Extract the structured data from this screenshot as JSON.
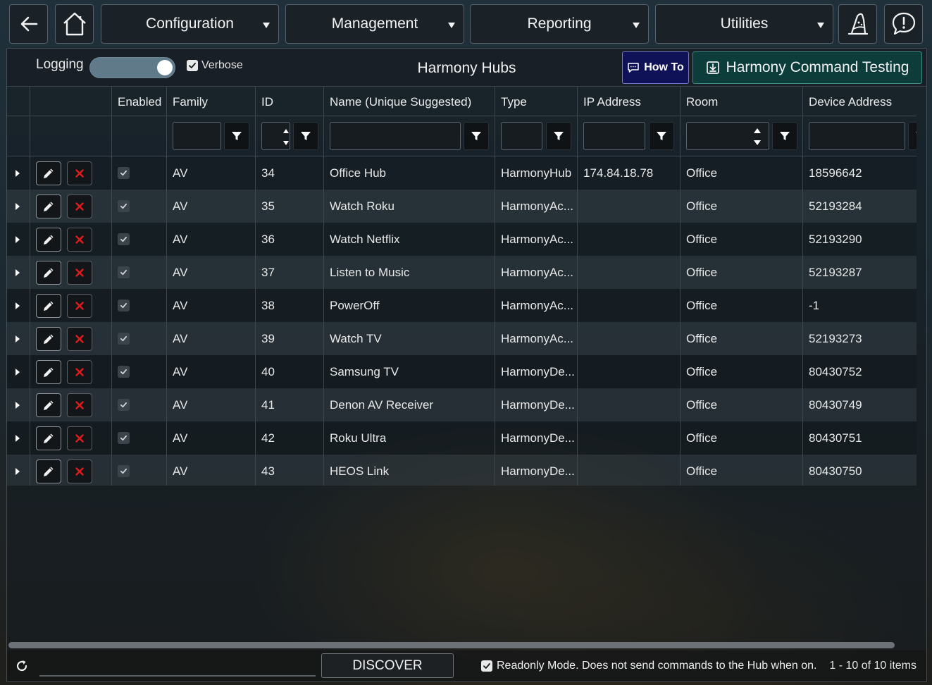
{
  "nav": {
    "menus": [
      "Configuration",
      "Management",
      "Reporting",
      "Utilities"
    ],
    "icons": [
      "back-arrow-icon",
      "home-icon",
      "wizard-icon",
      "alert-icon"
    ]
  },
  "toolbar": {
    "logging_label": "Logging",
    "logging_on": true,
    "verbose_label": "Verbose",
    "verbose_checked": true,
    "title": "Harmony Hubs",
    "howto_label": "How To",
    "testing_label": "Harmony Command Testing"
  },
  "grid": {
    "headers": [
      "Enabled",
      "Family",
      "ID",
      "Name (Unique Suggested)",
      "Type",
      "IP Address",
      "Room",
      "Device Address"
    ],
    "rows": [
      {
        "enabled": true,
        "family": "AV",
        "id": "34",
        "name": "Office Hub",
        "type": "HarmonyHub",
        "ip": "174.84.18.78",
        "room": "Office",
        "address": "18596642"
      },
      {
        "enabled": true,
        "family": "AV",
        "id": "35",
        "name": "Watch Roku",
        "type": "HarmonyAc...",
        "ip": "",
        "room": "Office",
        "address": "52193284"
      },
      {
        "enabled": true,
        "family": "AV",
        "id": "36",
        "name": "Watch Netflix",
        "type": "HarmonyAc...",
        "ip": "",
        "room": "Office",
        "address": "52193290"
      },
      {
        "enabled": true,
        "family": "AV",
        "id": "37",
        "name": "Listen to Music",
        "type": "HarmonyAc...",
        "ip": "",
        "room": "Office",
        "address": "52193287"
      },
      {
        "enabled": true,
        "family": "AV",
        "id": "38",
        "name": "PowerOff",
        "type": "HarmonyAc...",
        "ip": "",
        "room": "Office",
        "address": "-1"
      },
      {
        "enabled": true,
        "family": "AV",
        "id": "39",
        "name": "Watch TV",
        "type": "HarmonyAc...",
        "ip": "",
        "room": "Office",
        "address": "52193273"
      },
      {
        "enabled": true,
        "family": "AV",
        "id": "40",
        "name": "Samsung TV",
        "type": "HarmonyDe...",
        "ip": "",
        "room": "Office",
        "address": "80430752"
      },
      {
        "enabled": true,
        "family": "AV",
        "id": "41",
        "name": "Denon AV Receiver",
        "type": "HarmonyDe...",
        "ip": "",
        "room": "Office",
        "address": "80430749"
      },
      {
        "enabled": true,
        "family": "AV",
        "id": "42",
        "name": "Roku Ultra",
        "type": "HarmonyDe...",
        "ip": "",
        "room": "Office",
        "address": "80430751"
      },
      {
        "enabled": true,
        "family": "AV",
        "id": "43",
        "name": "HEOS Link",
        "type": "HarmonyDe...",
        "ip": "",
        "room": "Office",
        "address": "80430750"
      }
    ]
  },
  "footer": {
    "discover_label": "DISCOVER",
    "readonly_checked": true,
    "readonly_label": "Readonly Mode. Does not send commands to the Hub when on.",
    "items_text": "1 - 10 of 10 items"
  },
  "colors": {
    "howto_bg": "#0f1256",
    "testing_bg": "#0c3d3b",
    "delete_x": "#e21b1b",
    "toggle": "#607a8a"
  }
}
